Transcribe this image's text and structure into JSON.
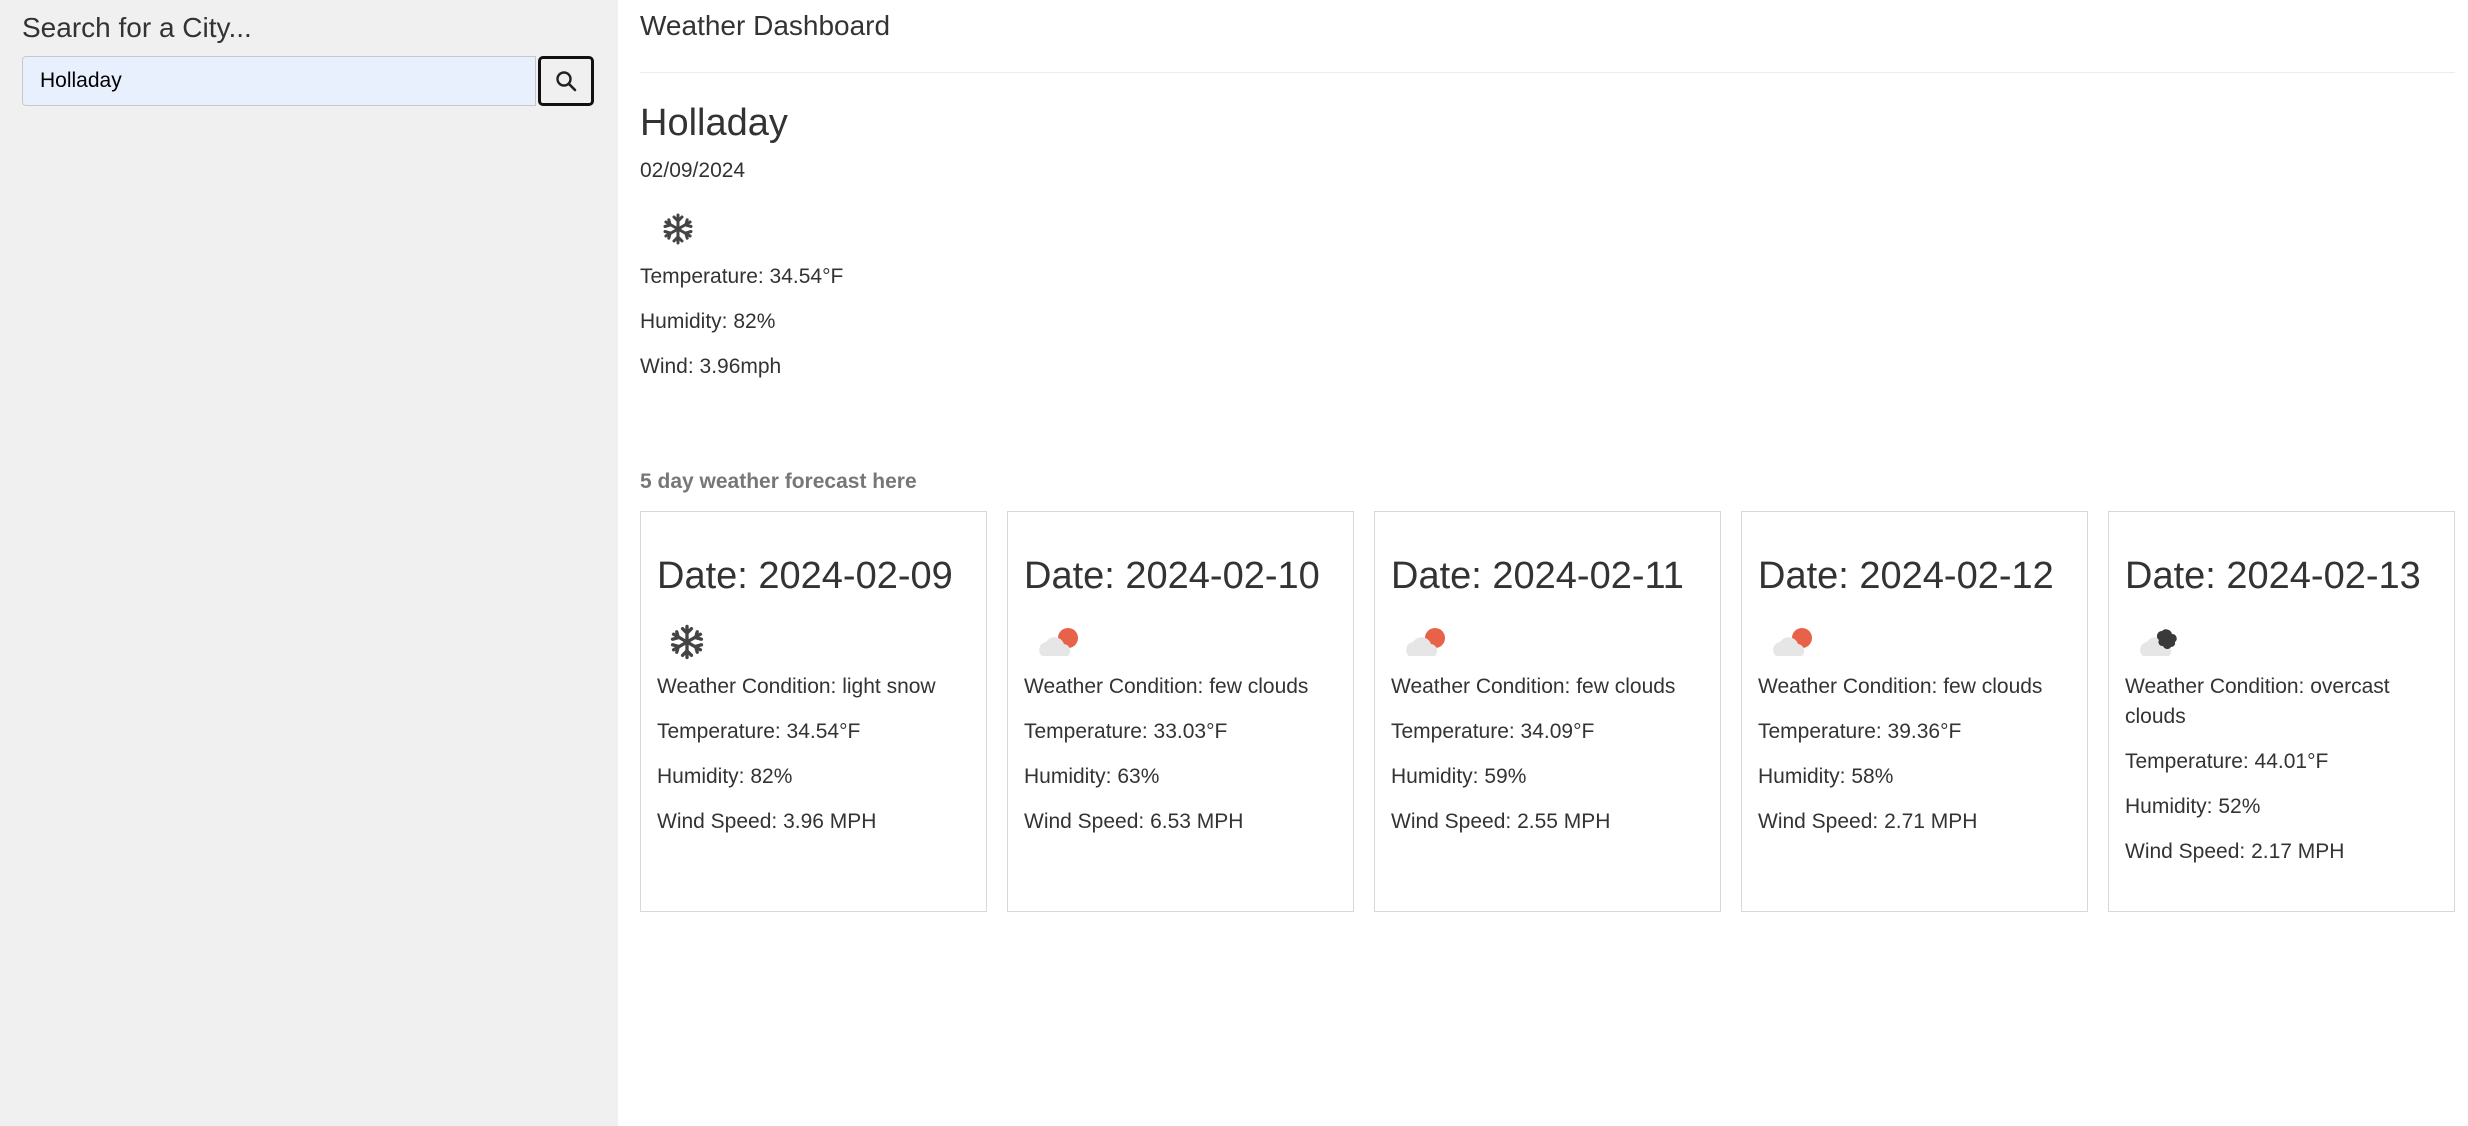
{
  "sidebar": {
    "title": "Search for a City...",
    "search_value": "Holladay",
    "search_button_icon": "search-icon"
  },
  "header": {
    "title": "Weather Dashboard"
  },
  "current": {
    "city": "Holladay",
    "date": "02/09/2024",
    "icon": "snow-icon",
    "temperature": "Temperature: 34.54°F",
    "humidity": "Humidity: 82%",
    "wind": "Wind: 3.96mph"
  },
  "forecast": {
    "heading": "5 day weather forecast here",
    "days": [
      {
        "date": "Date: 2024-02-09",
        "icon": "snow-icon",
        "condition": "Weather Condition: light snow",
        "temperature": "Temperature: 34.54°F",
        "humidity": "Humidity: 82%",
        "wind": "Wind Speed: 3.96 MPH"
      },
      {
        "date": "Date: 2024-02-10",
        "icon": "few-clouds-icon",
        "condition": "Weather Condition: few clouds",
        "temperature": "Temperature: 33.03°F",
        "humidity": "Humidity: 63%",
        "wind": "Wind Speed: 6.53 MPH"
      },
      {
        "date": "Date: 2024-02-11",
        "icon": "few-clouds-icon",
        "condition": "Weather Condition: few clouds",
        "temperature": "Temperature: 34.09°F",
        "humidity": "Humidity: 59%",
        "wind": "Wind Speed: 2.55 MPH"
      },
      {
        "date": "Date: 2024-02-12",
        "icon": "few-clouds-icon",
        "condition": "Weather Condition: few clouds",
        "temperature": "Temperature: 39.36°F",
        "humidity": "Humidity: 58%",
        "wind": "Wind Speed: 2.71 MPH"
      },
      {
        "date": "Date: 2024-02-13",
        "icon": "overcast-clouds-icon",
        "condition": "Weather Condition: overcast clouds",
        "temperature": "Temperature: 44.01°F",
        "humidity": "Humidity: 52%",
        "wind": "Wind Speed: 2.17 MPH"
      }
    ]
  },
  "colors": {
    "sidebar_bg": "#f0f0f0",
    "input_bg": "#e8f0fe",
    "sun_accent": "#e8624a",
    "cloud_light": "#e6e6e6",
    "cloud_dark": "#3a3a3a",
    "snow": "#444444"
  }
}
